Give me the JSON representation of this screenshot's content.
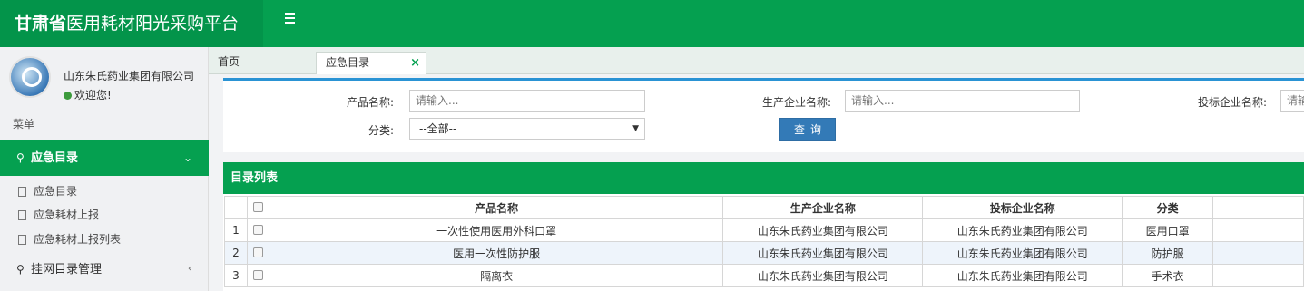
{
  "header": {
    "brand_bold": "甘肃省",
    "brand_rest": "医用耗材阳光采购平台",
    "menu_icon": "hamburger-icon"
  },
  "sidebar": {
    "user_name": "山东朱氏药业集团有限公司",
    "welcome": "欢迎您!",
    "menu_label": "菜单",
    "active_section": "应急目录",
    "sub_items": [
      "应急目录",
      "应急耗材上报",
      "应急耗材上报列表"
    ],
    "next_section": "挂网目录管理"
  },
  "tabs": {
    "home": "首页",
    "active": "应急目录",
    "close": "×"
  },
  "search": {
    "product_label": "产品名称:",
    "product_placeholder": "请输入...",
    "maker_label": "生产企业名称:",
    "maker_placeholder": "请输入...",
    "bidder_label": "投标企业名称:",
    "bidder_placeholder": "请输",
    "category_label": "分类:",
    "category_value": "--全部--",
    "query_button": "查询"
  },
  "list": {
    "title": "目录列表",
    "columns": [
      "产品名称",
      "生产企业名称",
      "投标企业名称",
      "分类"
    ],
    "rows": [
      {
        "no": "1",
        "name": "一次性使用医用外科口罩",
        "maker": "山东朱氏药业集团有限公司",
        "bidder": "山东朱氏药业集团有限公司",
        "category": "医用口罩"
      },
      {
        "no": "2",
        "name": "医用一次性防护服",
        "maker": "山东朱氏药业集团有限公司",
        "bidder": "山东朱氏药业集团有限公司",
        "category": "防护服"
      },
      {
        "no": "3",
        "name": "隔离衣",
        "maker": "山东朱氏药业集团有限公司",
        "bidder": "山东朱氏药业集团有限公司",
        "category": "手术衣"
      }
    ]
  },
  "colors": {
    "primary_green": "#05a050",
    "accent_blue": "#337ab7"
  }
}
